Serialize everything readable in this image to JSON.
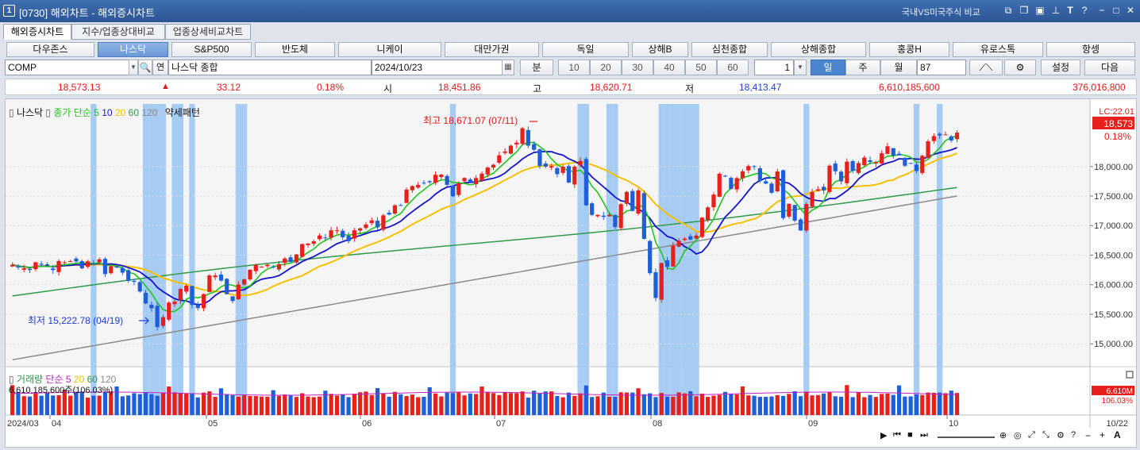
{
  "titlebar": {
    "app_num": "1",
    "title": "[0730] 해외차트 - 해외증시차트",
    "compare": "국내VS미국주식 비교"
  },
  "tabs": [
    "해외증시차트",
    "지수/업종상대비교",
    "업종상세비교차트"
  ],
  "markets": [
    "다우존스",
    "나스닥",
    "S&P500",
    "반도체",
    "니케이",
    "대만가권",
    "독일",
    "상해B",
    "심천종합",
    "상해종합",
    "홍콩H",
    "유로스톡",
    "항셍"
  ],
  "selected_market": 1,
  "controls": {
    "symbol": "COMP",
    "search_icon": "🔍",
    "related": "연",
    "name": "나스닥 종합",
    "date": "2024/10/23",
    "interval_label": "분",
    "minute_options": [
      "10",
      "20",
      "30",
      "40",
      "50",
      "60"
    ],
    "count": "1",
    "periods": [
      "일",
      "주",
      "월"
    ],
    "period_value": "87",
    "settings_label": "설정",
    "next_label": "다음"
  },
  "quote": {
    "price": "18,573.13",
    "arrow": "▲",
    "change": "33.12",
    "pct": "0.18%",
    "open_label": "시",
    "open": "18,451.86",
    "high_label": "고",
    "high": "18,620.71",
    "low_label": "저",
    "low": "18,413.47",
    "volume": "6,610,185,600",
    "amount": "376,016,800"
  },
  "legend": {
    "name": "나스닥",
    "price_label": "종가 단순",
    "ma": [
      "5",
      "10",
      "20",
      "60",
      "120"
    ],
    "pattern": "약세패턴",
    "vol_name": "거래량",
    "vol_simple": "단순",
    "vol_ma": [
      "5",
      "20",
      "60",
      "120"
    ],
    "vol_value": "6,610,185,600주(106.03%)"
  },
  "annotations": {
    "high": "최고 18,671.07 (07/11)",
    "low": "최저 15,222.78 (04/19)"
  },
  "price_axis": {
    "lc": "LC:22.01",
    "current": "18,573",
    "pct": "0.18%",
    "ticks": [
      "18,000.00",
      "17,500.00",
      "17,000.00",
      "16,500.00",
      "16,000.00",
      "15,500.00",
      "15,000.00"
    ]
  },
  "volume_axis": {
    "value": "6.610M",
    "pct": "106.03%"
  },
  "date_axis": {
    "start": "2024/03",
    "months": [
      "04",
      "05",
      "06",
      "07",
      "08",
      "09",
      "10"
    ],
    "end": "10/22"
  },
  "colors": {
    "up": "#e8201c",
    "down": "#1e5fd8",
    "ma5": "#22c41e",
    "ma10": "#1414c8",
    "ma20": "#f5c000",
    "ma60": "#2e9a4a",
    "ma120": "#8a8a8a",
    "highlight": "#9fc8f4"
  },
  "chart_data": {
    "type": "candlestick",
    "y_range": [
      14600,
      18950
    ],
    "sessions": 161,
    "closes": [
      16339,
      16291,
      16278,
      16249,
      16379,
      16340,
      16315,
      16248,
      16400,
      16380,
      16399,
      16394,
      16277,
      16395,
      16342,
      16428,
      16181,
      16314,
      16290,
      16205,
      16065,
      16049,
      15885,
      15683,
      15601,
      15282,
      15451,
      15697,
      15713,
      15928,
      15983,
      15658,
      15605,
      15841,
      16157,
      16156,
      16069,
      15840,
      15724,
      16003,
      16092,
      16253,
      16332,
      16303,
      16340,
      16302,
      16349,
      16444,
      16388,
      16511,
      16687,
      16697,
      16735,
      16832,
      16795,
      16920,
      16921,
      16802,
      16736,
      16920,
      16954,
      17019,
      17088,
      16970,
      17173,
      17187,
      17344,
      17343,
      17608,
      17668,
      17689,
      17721,
      17733,
      17858,
      17862,
      17689,
      17496,
      17717,
      17806,
      17733,
      17805,
      17879,
      17982,
      18029,
      18188,
      18254,
      18352,
      18403,
      18647,
      18352,
      18283,
      18008,
      17997,
      18007,
      17870,
      17997,
      17728,
      17996,
      18093,
      17342,
      17181,
      17182,
      17147,
      17182,
      16975,
      17362,
      17570,
      17249,
      17595,
      16776,
      16195,
      15776,
      16367,
      16303,
      16660,
      16745,
      16780,
      16764,
      16831,
      17134,
      17308,
      17525,
      17876,
      17843,
      17620,
      17803,
      17918,
      18008,
      17992,
      17754,
      17711,
      17555,
      17916,
      17128,
      17368,
      17084,
      16917,
      17365,
      17570,
      17614,
      17594,
      18013,
      17919,
      17747,
      18082,
      17926,
      18058,
      18150,
      18077,
      18076,
      18223,
      18342,
      18183,
      18189,
      18013,
      18056,
      17924,
      18180,
      18425,
      18513,
      18526,
      18542,
      18440,
      18573
    ],
    "highlight_sessions": [
      14,
      23,
      24,
      25,
      26,
      28,
      29,
      31,
      39,
      40,
      76,
      98,
      99,
      103,
      104,
      112,
      113,
      114,
      115,
      116,
      117,
      118,
      137,
      156,
      160
    ],
    "annotations": [
      "최고 18,671.07 (07/11)",
      "최저 15,222.78 (04/19)"
    ]
  }
}
